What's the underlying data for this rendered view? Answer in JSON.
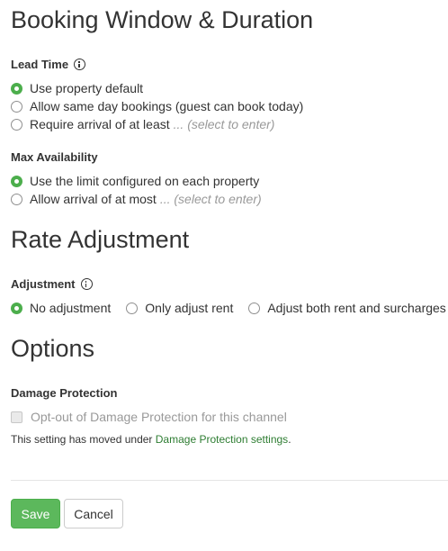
{
  "booking": {
    "title": "Booking Window & Duration",
    "lead_time": {
      "label": "Lead Time",
      "options": [
        {
          "label": "Use property default",
          "hint": "",
          "checked": true
        },
        {
          "label": "Allow same day bookings (guest can book today)",
          "hint": "",
          "checked": false
        },
        {
          "label": "Require arrival of at least",
          "hint": "... (select to enter)",
          "checked": false
        }
      ]
    },
    "max_availability": {
      "label": "Max Availability",
      "options": [
        {
          "label": "Use the limit configured on each property",
          "hint": "",
          "checked": true
        },
        {
          "label": "Allow arrival of at most",
          "hint": "... (select to enter)",
          "checked": false
        }
      ]
    }
  },
  "rate": {
    "title": "Rate Adjustment",
    "adjustment": {
      "label": "Adjustment",
      "options": [
        {
          "label": "No adjustment",
          "checked": true
        },
        {
          "label": "Only adjust rent",
          "checked": false
        },
        {
          "label": "Adjust both rent and surcharges",
          "checked": false
        }
      ]
    }
  },
  "options": {
    "title": "Options",
    "damage": {
      "label": "Damage Protection",
      "checkbox_label": "Opt-out of Damage Protection for this channel",
      "checked": false,
      "disabled": true,
      "note_prefix": "This setting has moved under ",
      "note_link": "Damage Protection settings",
      "note_suffix": "."
    }
  },
  "actions": {
    "save_label": "Save",
    "cancel_label": "Cancel"
  },
  "colors": {
    "accent_green": "#5cb85c",
    "link_green": "#2e7d32",
    "radio_checked": "#4cae4c"
  }
}
